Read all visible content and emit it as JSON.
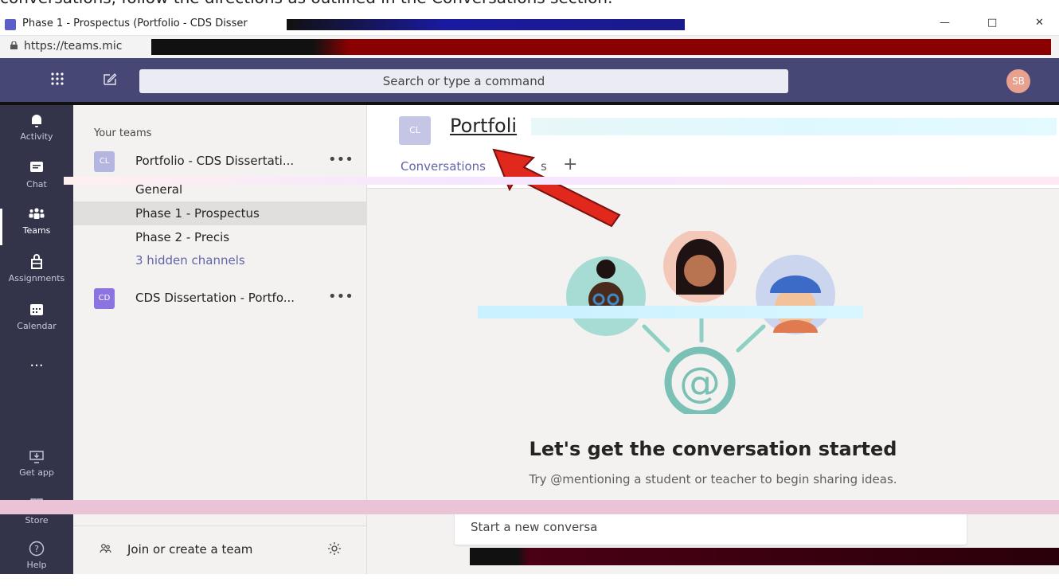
{
  "instruction": "conversations, follow the directions as outlined in the Conversations section.",
  "browser": {
    "tab_title": "Phase 1 - Prospectus (Portfolio - CDS Disser",
    "url": "https://teams.mic"
  },
  "header": {
    "search_placeholder": "Search or type a command",
    "avatar_initials": "SB"
  },
  "rail": [
    {
      "label": "Activity",
      "icon": "bell-icon"
    },
    {
      "label": "Chat",
      "icon": "chat-icon"
    },
    {
      "label": "Teams",
      "icon": "teams-icon"
    },
    {
      "label": "Assignments",
      "icon": "assignments-icon"
    },
    {
      "label": "Calendar",
      "icon": "calendar-icon"
    },
    {
      "label": "...",
      "icon": "more-icon"
    },
    {
      "label": "Get app",
      "icon": "download-icon"
    },
    {
      "label": "Store",
      "icon": "store-icon"
    },
    {
      "label": "Help",
      "icon": "help-icon"
    }
  ],
  "teams_panel": {
    "heading": "Your teams",
    "teams": [
      {
        "tile": "CL",
        "name": "Portfolio - CDS Dissertati...",
        "more": "•••",
        "tile_color": "#b4b5e0"
      },
      {
        "tile": "CD",
        "name": "CDS Dissertation - Portfo...",
        "more": "•••",
        "tile_color": "#8b74e0"
      }
    ],
    "channels": [
      "General",
      "Phase 1 - Prospectus",
      "Phase 2 - Precis",
      "3 hidden channels"
    ],
    "selected_channel": "Phase 1 - Prospectus",
    "footer": {
      "join_label": "Join or create a team"
    }
  },
  "channel": {
    "tile": "CL",
    "title": "Portfoli",
    "tabs": [
      "Conversations",
      "s"
    ],
    "empty_title": "Let's get the conversation started",
    "empty_subtitle": "Try @mentioning a student or teacher to begin sharing ideas.",
    "compose_placeholder": "Start a new conversa"
  },
  "colors": {
    "header": "#464775",
    "rail": "#33344a",
    "accent": "#6264a7",
    "arrow": "#e0281c"
  }
}
